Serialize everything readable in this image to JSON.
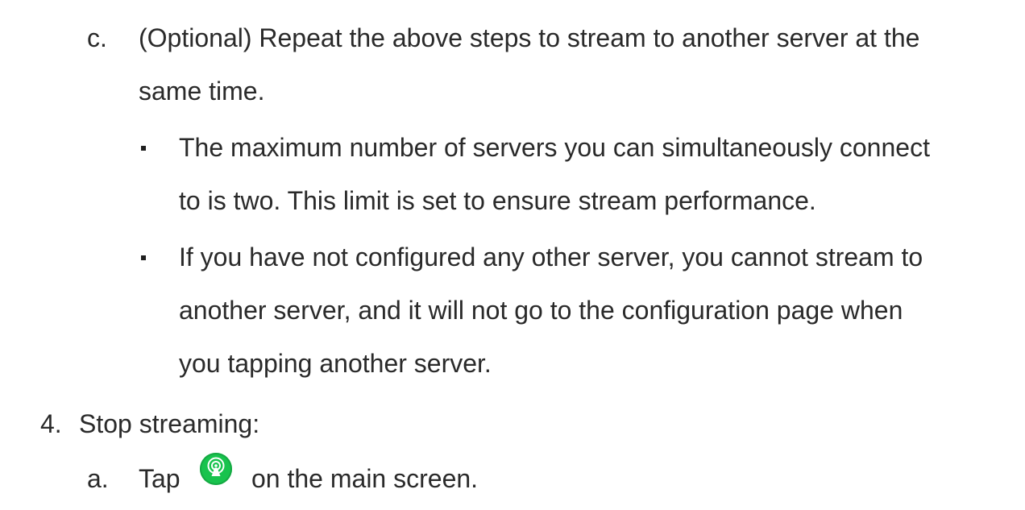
{
  "content": {
    "item_c": {
      "marker": "c.",
      "lines": [
        "(Optional) Repeat the above steps to stream to another server at the",
        "same time."
      ]
    },
    "bullets": [
      {
        "lines": [
          "The maximum number of servers you can simultaneously connect",
          "to is two. This limit is set to ensure stream performance."
        ]
      },
      {
        "lines": [
          "If you have not configured any other server, you cannot stream to",
          "another server, and it will not go to the configuration page when",
          "you tapping another server."
        ]
      }
    ],
    "step_4": {
      "marker": "4.",
      "text": "Stop streaming:"
    },
    "item_a": {
      "marker": "a.",
      "text_before": "Tap",
      "icon": "live-stream-icon",
      "text_after": "on the main screen."
    }
  },
  "colors": {
    "text": "#2a2a2a",
    "icon_green": "#18c34d"
  }
}
